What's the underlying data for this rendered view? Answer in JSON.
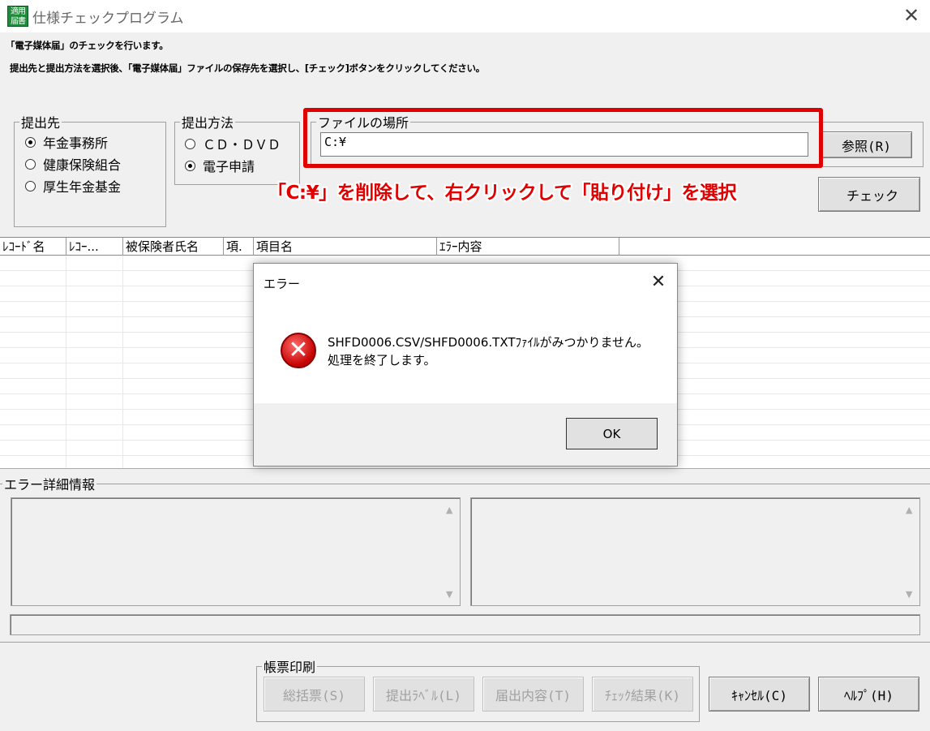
{
  "window": {
    "title": "仕様チェックプログラム",
    "icon_text": "適用届書",
    "close_glyph": "✕"
  },
  "description": {
    "line1": "「電子媒体届」のチェックを行います。",
    "line2": "提出先と提出方法を選択後、「電子媒体届」ファイルの保存先を選択し、[チェック]ボタンをクリックしてください。"
  },
  "submit_to": {
    "legend": "提出先",
    "options": [
      {
        "label": "年金事務所",
        "checked": true
      },
      {
        "label": "健康保険組合",
        "checked": false
      },
      {
        "label": "厚生年金基金",
        "checked": false
      }
    ]
  },
  "submit_method": {
    "legend": "提出方法",
    "options": [
      {
        "label": "ＣＤ・ＤＶＤ",
        "checked": false
      },
      {
        "label": "電子申請",
        "checked": true
      }
    ]
  },
  "file_location": {
    "legend": "ファイルの場所",
    "value": "C:¥",
    "browse_label": "参照(R)",
    "check_label": "チェック"
  },
  "annotation": {
    "text": "「C:¥」を削除して、右クリックして「貼り付け」を選択",
    "color": "#e00000"
  },
  "grid": {
    "columns": [
      "ﾚｺｰﾄﾞ名",
      "ﾚｺｰ...",
      "被保険者氏名",
      "項.",
      "項目名",
      "ｴﾗｰ内容"
    ]
  },
  "dialog": {
    "title": "エラー",
    "close_glyph": "✕",
    "icon": "error-icon",
    "message_line1": "SHFD0006.CSV/SHFD0006.TXTﾌｧｲﾙがみつかりません。",
    "message_line2": "処理を終了します。",
    "ok_label": "OK"
  },
  "error_detail": {
    "legend": "エラー詳細情報"
  },
  "report_print": {
    "legend": "帳票印刷",
    "buttons": [
      "総括票(S)",
      "提出ﾗﾍﾞﾙ(L)",
      "届出内容(T)",
      "ﾁｪｯｸ結果(K)"
    ]
  },
  "bottom_buttons": {
    "cancel_label": "ｷｬﾝｾﾙ(C)",
    "help_label": "ﾍﾙﾌﾟ(H)"
  }
}
